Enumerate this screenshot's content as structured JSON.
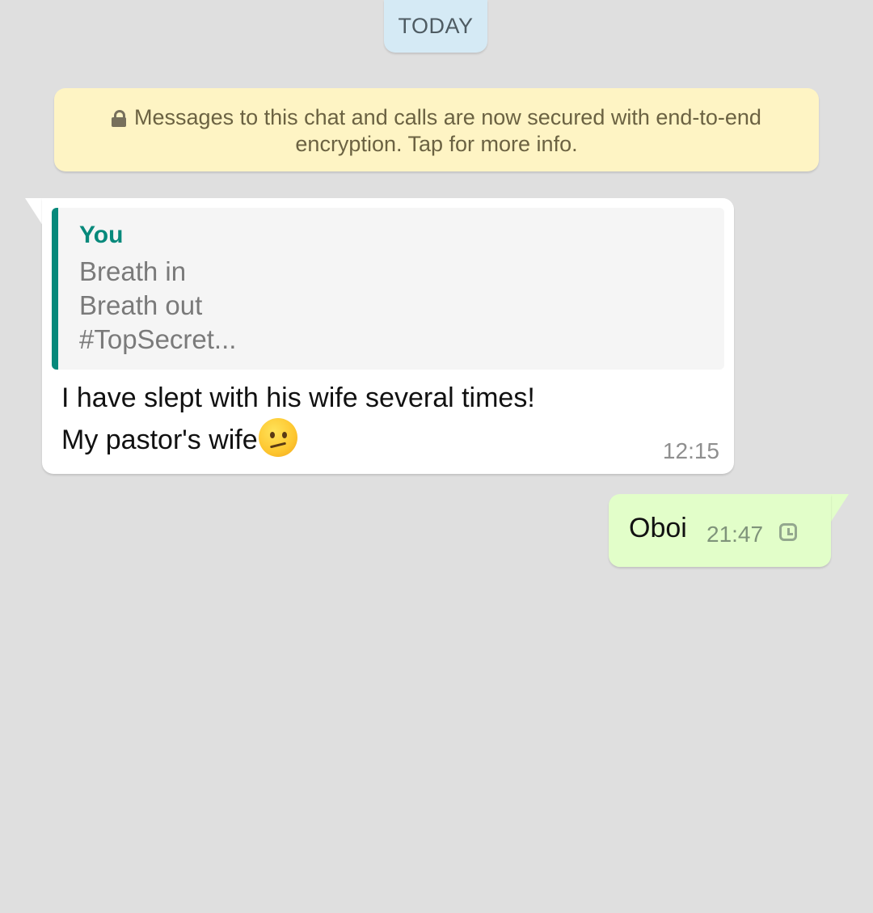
{
  "date_chip": {
    "label": "TODAY"
  },
  "encryption_notice": {
    "icon": "lock-icon",
    "text": "Messages to this chat and calls are now secured with end-to-end encryption. Tap for more info."
  },
  "incoming_message": {
    "quoted": {
      "author": "You",
      "lines": [
        "Breath in",
        "Breath out",
        "#TopSecret..."
      ]
    },
    "lines": [
      "I have slept with his wife several times!",
      "My pastor's wife"
    ],
    "emoji": "confused-face-emoji",
    "time": "12:15"
  },
  "outgoing_message": {
    "text": "Oboi",
    "time": "21:47",
    "status_icon": "clock-icon"
  },
  "colors": {
    "chat_background": "#dfdfdf",
    "date_chip": "#d5eaf5",
    "encryption_notice": "#fef4c4",
    "incoming_bubble": "#ffffff",
    "outgoing_bubble": "#e2fec9",
    "quote_accent": "#07897b"
  }
}
